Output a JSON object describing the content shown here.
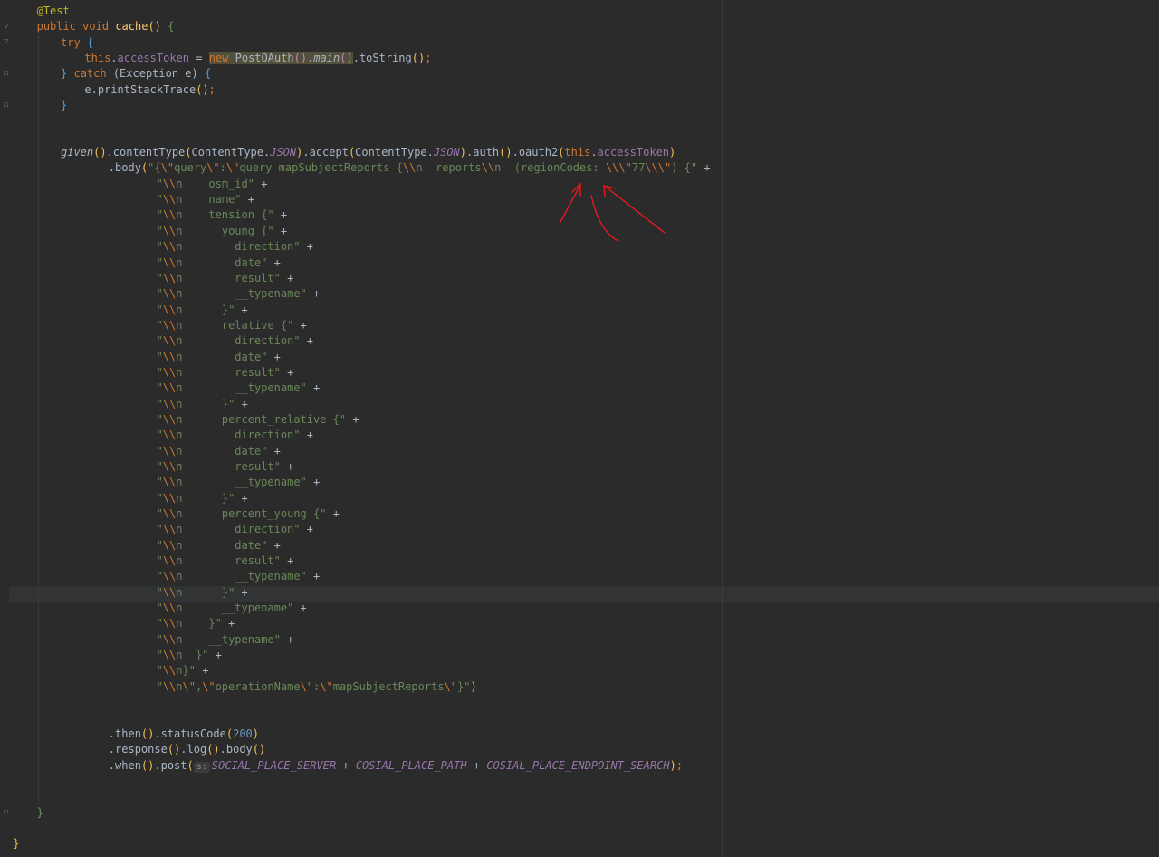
{
  "editor": {
    "annotation": "@Test",
    "method": {
      "modifiers": "public void",
      "name": "cache",
      "sig": "()"
    },
    "try_kw": "try",
    "catch_kw": "catch",
    "exception_decl": "(Exception e)",
    "assign_target": "this",
    "access_token": "accessToken",
    "new_kw": "new",
    "class_name": "PostOAuth",
    "main_call": "main",
    "to_string": "toString",
    "print_stack": "e.printStackTrace",
    "given": "given",
    "content_type": "contentType",
    "content_type_class": "ContentType",
    "json_const": "JSON",
    "accept": "accept",
    "auth": "auth",
    "oauth2": "oauth2",
    "body_call": "body",
    "query_head": "{\\\"query\\\":\\\"query mapSubjectReports {\\\\n  reports\\\\n  (regionCodes: \\\\\\\"77\\\\\\\") {\" +",
    "body_lines": [
      "\"\\\\n    osm_id\" +",
      "\"\\\\n    name\" +",
      "\"\\\\n    tension {\" +",
      "\"\\\\n      young {\" +",
      "\"\\\\n        direction\" +",
      "\"\\\\n        date\" +",
      "\"\\\\n        result\" +",
      "\"\\\\n        __typename\" +",
      "\"\\\\n      }\" +",
      "\"\\\\n      relative {\" +",
      "\"\\\\n        direction\" +",
      "\"\\\\n        date\" +",
      "\"\\\\n        result\" +",
      "\"\\\\n        __typename\" +",
      "\"\\\\n      }\" +",
      "\"\\\\n      percent_relative {\" +",
      "\"\\\\n        direction\" +",
      "\"\\\\n        date\" +",
      "\"\\\\n        result\" +",
      "\"\\\\n        __typename\" +",
      "\"\\\\n      }\" +",
      "\"\\\\n      percent_young {\" +",
      "\"\\\\n        direction\" +",
      "\"\\\\n        date\" +",
      "\"\\\\n        result\" +",
      "\"\\\\n        __typename\" +",
      "\"\\\\n      }\" +",
      "\"\\\\n      __typename\" +",
      "\"\\\\n    }\" +",
      "\"\\\\n    __typename\" +",
      "\"\\\\n  }\" +",
      "\"\\\\n}\" +",
      "\"\\\\n\\\",\\\"operationName\\\":\\\"mapSubjectReports\\\"}\")"
    ],
    "then_call": "then",
    "status_code": "statusCode",
    "status_value": "200",
    "response_call": "response",
    "log_call": "log",
    "body_end": "body",
    "when_call": "when",
    "post_call": "post",
    "param_hint": "s:",
    "server_const": "SOCIAL_PLACE_SERVER",
    "path_const": "COSIAL_PLACE_PATH",
    "endpoint_const": "COSIAL_PLACE_ENDPOINT_SEARCH",
    "close_brace": "}"
  },
  "colors": {
    "background": "#2b2b2b",
    "keyword": "#cc7832",
    "string": "#6a8759",
    "field": "#9876aa",
    "method": "#ffc66d",
    "number": "#6897bb",
    "annotation": "#bbb529",
    "arrow": "#e8191f"
  }
}
